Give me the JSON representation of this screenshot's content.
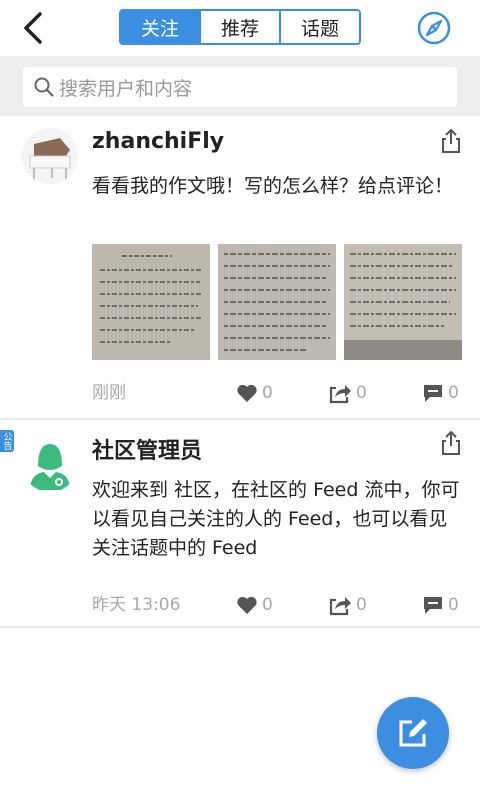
{
  "header": {
    "tabs": [
      {
        "label": "关注",
        "active": true
      },
      {
        "label": "推荐",
        "active": false
      },
      {
        "label": "话题",
        "active": false
      }
    ],
    "back_icon": "back-arrow-icon",
    "discover_icon": "compass-icon"
  },
  "search": {
    "placeholder": "搜索用户和内容",
    "icon": "search-icon"
  },
  "feed": [
    {
      "username": "zhanchiFly",
      "content": "看看我的作文哦！写的怎么样？给点评论！",
      "image_count": 3,
      "time": "刚刚",
      "likes": "0",
      "reposts": "0",
      "comments": "0"
    },
    {
      "username": "社区管理员",
      "badge": "公告",
      "content": "欢迎来到 社区，在社区的 Feed 流中，你可以看见自己关注的人的 Feed，也可以看见关注话题中的 Feed",
      "time": "昨天 13:06",
      "likes": "0",
      "reposts": "0",
      "comments": "0"
    }
  ],
  "fab": {
    "icon": "edit-icon"
  },
  "colors": {
    "accent": "#3b8ee0",
    "meta_gray": "#a8a8a8",
    "icon_gray": "#555555",
    "search_bg": "#eeeeee",
    "admin_avatar": "#3dbb7f"
  }
}
